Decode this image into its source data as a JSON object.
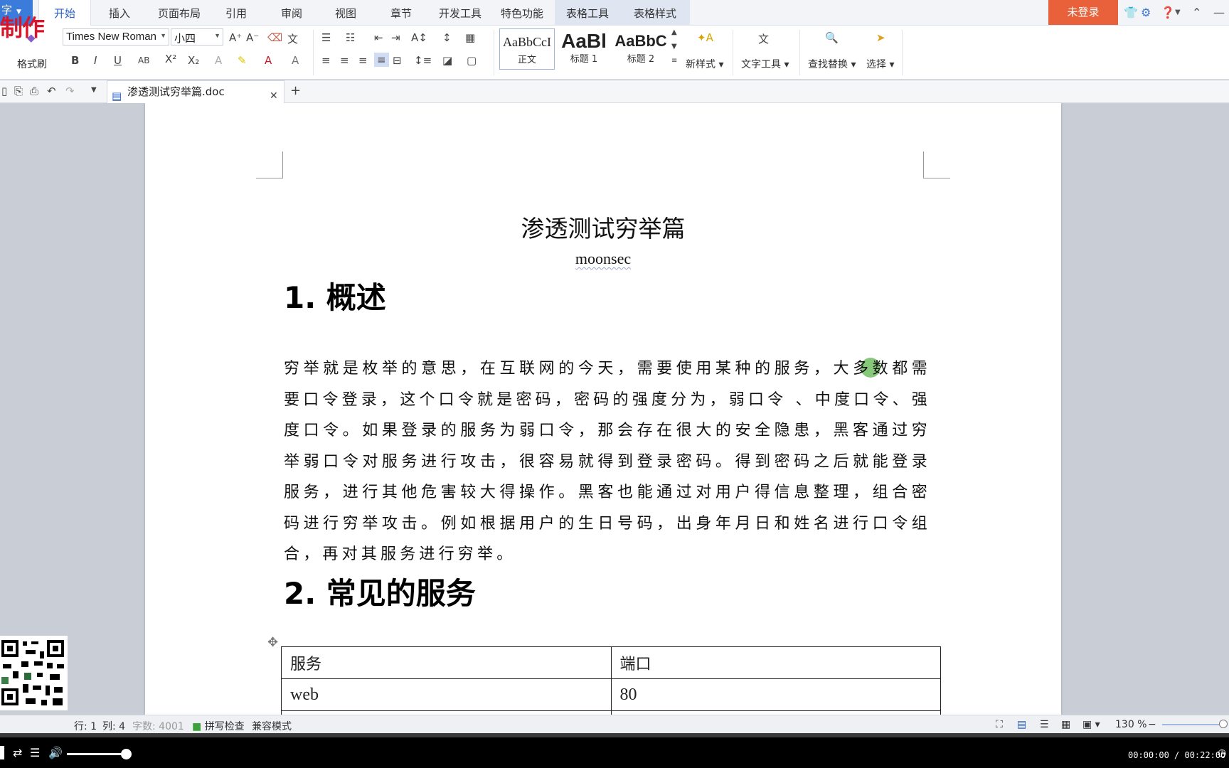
{
  "tabs": {
    "app_label": "字",
    "brand_overlay": "制作",
    "items": [
      "开始",
      "插入",
      "页面布局",
      "引用",
      "审阅",
      "视图",
      "章节",
      "开发工具",
      "特色功能",
      "表格工具",
      "表格样式"
    ],
    "login": "未登录"
  },
  "ribbon": {
    "format_painter": "格式刷",
    "font_name": "Times New Roman",
    "font_size": "小四",
    "styles": [
      {
        "sample": "AaBbCcI",
        "name": "正文"
      },
      {
        "sample": "AaBl",
        "name": "标题 1"
      },
      {
        "sample": "AaBbC",
        "name": "标题 2"
      }
    ],
    "new_style": "新样式",
    "text_tools": "文字工具",
    "find_replace": "查找替换",
    "select": "选择"
  },
  "doctab": {
    "filename": "渗透测试穷举篇.doc"
  },
  "document": {
    "title": "渗透测试穷举篇",
    "subtitle": "moonsec",
    "heading1": "1. 概述",
    "paragraph": "穷举就是枚举的意思，在互联网的今天，需要使用某种的服务，大多数都需要口令登录，这个口令就是密码，密码的强度分为，弱口令 、中度口令、强度口令。如果登录的服务为弱口令，那会存在很大的安全隐患，黑客通过穷举弱口令对服务进行攻击，很容易就得到登录密码。得到密码之后就能登录服务，进行其他危害较大得操作。黑客也能通过对用户得信息整理，组合密码进行穷举攻击。例如根据用户的生日号码，出身年月日和姓名进行口令组合，再对其服务进行穷举。",
    "heading2": "2. 常见的服务",
    "table": {
      "header": [
        "服务",
        "端口"
      ],
      "rows": [
        [
          "web",
          "80"
        ]
      ]
    }
  },
  "statusbar": {
    "row": "行: 1",
    "col": "列: 4",
    "word_count": "字数: 4001",
    "spell_check": "拼写检查",
    "compat_mode": "兼容模式",
    "zoom": "130 %"
  },
  "player": {
    "time": "00:00:00 / 00:22:00"
  },
  "colors": {
    "accent": "#3b7bd9",
    "login_bg": "#e9613a",
    "brand_red": "#d8162b",
    "cursor_dot": "#46aa32"
  }
}
